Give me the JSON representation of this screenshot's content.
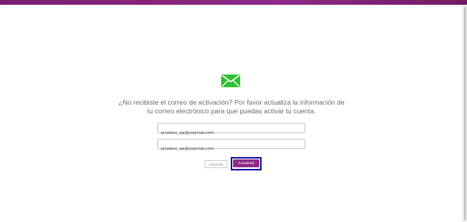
{
  "colors": {
    "brand": "#8e2a86",
    "icon": "#2fbf2f",
    "focus": "#1a1aa6"
  },
  "icon": "envelope-icon",
  "message": {
    "line1": "¿No recibiste el correo de activación? Por favor actualiza la información de",
    "line2": "tu correo electrónico para que puedas activar tu cuenta."
  },
  "form": {
    "email": "pruebas_qa@yopmail.com",
    "email_confirm": "pruebas_qa@yopmail.com",
    "cancel_label": "Cancelar",
    "update_label": "Actualizar"
  }
}
